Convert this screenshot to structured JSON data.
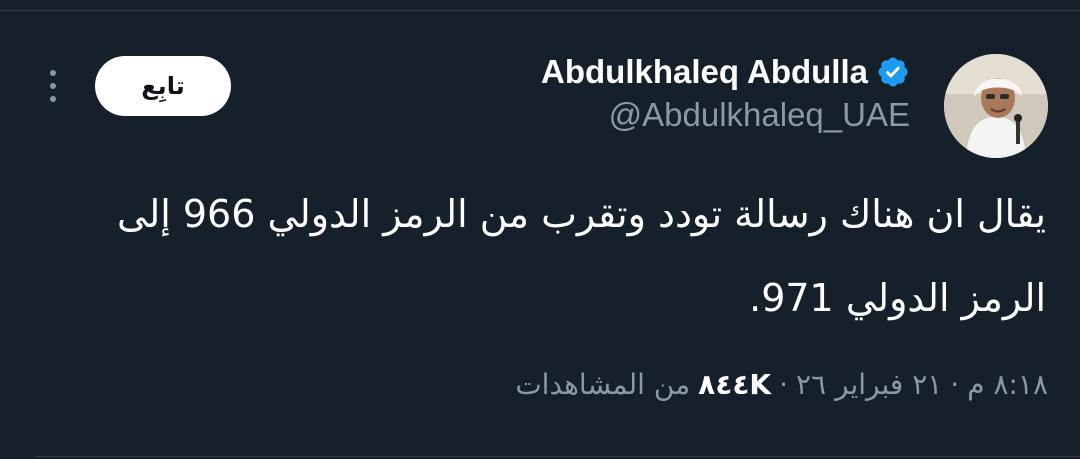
{
  "author": {
    "display_name": "Abdulkhaleq Abdulla",
    "handle": "@Abdulkhaleq_UAE",
    "verified": true,
    "verified_color": "#1d9bf0"
  },
  "actions": {
    "follow_label": "تابِع",
    "more_icon": "more-vertical-icon"
  },
  "tweet": {
    "text": "يقال ان هناك رسالة تودد وتقرب من الرمز الدولي 966 إلى الرمز الدولي 971."
  },
  "meta": {
    "time": "٨:١٨ م",
    "separator": "·",
    "date": "٢١ فبراير ٢٦",
    "views_count": "٨٤٤K",
    "views_label": "من المشاهدات"
  },
  "colors": {
    "background": "#15202b",
    "text_primary": "#ffffff",
    "text_secondary": "#8b98a5"
  }
}
